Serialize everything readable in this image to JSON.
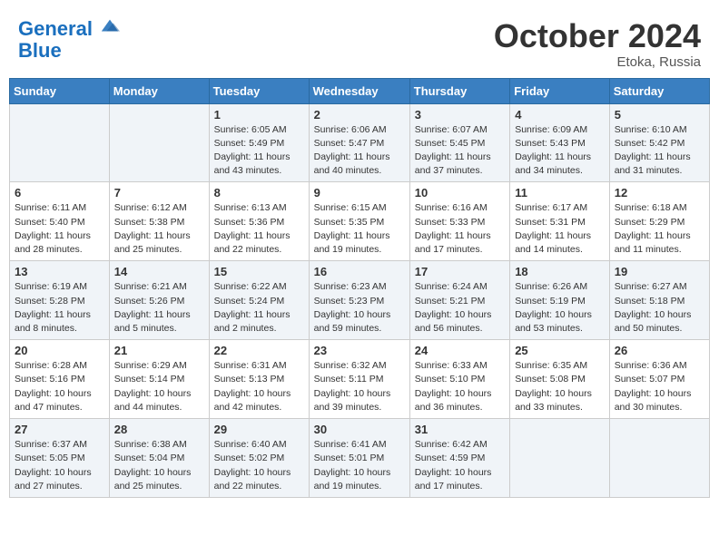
{
  "header": {
    "logo_line1": "General",
    "logo_line2": "Blue",
    "month": "October 2024",
    "location": "Etoka, Russia"
  },
  "weekdays": [
    "Sunday",
    "Monday",
    "Tuesday",
    "Wednesday",
    "Thursday",
    "Friday",
    "Saturday"
  ],
  "weeks": [
    [
      {
        "day": "",
        "info": ""
      },
      {
        "day": "",
        "info": ""
      },
      {
        "day": "1",
        "info": "Sunrise: 6:05 AM\nSunset: 5:49 PM\nDaylight: 11 hours and 43 minutes."
      },
      {
        "day": "2",
        "info": "Sunrise: 6:06 AM\nSunset: 5:47 PM\nDaylight: 11 hours and 40 minutes."
      },
      {
        "day": "3",
        "info": "Sunrise: 6:07 AM\nSunset: 5:45 PM\nDaylight: 11 hours and 37 minutes."
      },
      {
        "day": "4",
        "info": "Sunrise: 6:09 AM\nSunset: 5:43 PM\nDaylight: 11 hours and 34 minutes."
      },
      {
        "day": "5",
        "info": "Sunrise: 6:10 AM\nSunset: 5:42 PM\nDaylight: 11 hours and 31 minutes."
      }
    ],
    [
      {
        "day": "6",
        "info": "Sunrise: 6:11 AM\nSunset: 5:40 PM\nDaylight: 11 hours and 28 minutes."
      },
      {
        "day": "7",
        "info": "Sunrise: 6:12 AM\nSunset: 5:38 PM\nDaylight: 11 hours and 25 minutes."
      },
      {
        "day": "8",
        "info": "Sunrise: 6:13 AM\nSunset: 5:36 PM\nDaylight: 11 hours and 22 minutes."
      },
      {
        "day": "9",
        "info": "Sunrise: 6:15 AM\nSunset: 5:35 PM\nDaylight: 11 hours and 19 minutes."
      },
      {
        "day": "10",
        "info": "Sunrise: 6:16 AM\nSunset: 5:33 PM\nDaylight: 11 hours and 17 minutes."
      },
      {
        "day": "11",
        "info": "Sunrise: 6:17 AM\nSunset: 5:31 PM\nDaylight: 11 hours and 14 minutes."
      },
      {
        "day": "12",
        "info": "Sunrise: 6:18 AM\nSunset: 5:29 PM\nDaylight: 11 hours and 11 minutes."
      }
    ],
    [
      {
        "day": "13",
        "info": "Sunrise: 6:19 AM\nSunset: 5:28 PM\nDaylight: 11 hours and 8 minutes."
      },
      {
        "day": "14",
        "info": "Sunrise: 6:21 AM\nSunset: 5:26 PM\nDaylight: 11 hours and 5 minutes."
      },
      {
        "day": "15",
        "info": "Sunrise: 6:22 AM\nSunset: 5:24 PM\nDaylight: 11 hours and 2 minutes."
      },
      {
        "day": "16",
        "info": "Sunrise: 6:23 AM\nSunset: 5:23 PM\nDaylight: 10 hours and 59 minutes."
      },
      {
        "day": "17",
        "info": "Sunrise: 6:24 AM\nSunset: 5:21 PM\nDaylight: 10 hours and 56 minutes."
      },
      {
        "day": "18",
        "info": "Sunrise: 6:26 AM\nSunset: 5:19 PM\nDaylight: 10 hours and 53 minutes."
      },
      {
        "day": "19",
        "info": "Sunrise: 6:27 AM\nSunset: 5:18 PM\nDaylight: 10 hours and 50 minutes."
      }
    ],
    [
      {
        "day": "20",
        "info": "Sunrise: 6:28 AM\nSunset: 5:16 PM\nDaylight: 10 hours and 47 minutes."
      },
      {
        "day": "21",
        "info": "Sunrise: 6:29 AM\nSunset: 5:14 PM\nDaylight: 10 hours and 44 minutes."
      },
      {
        "day": "22",
        "info": "Sunrise: 6:31 AM\nSunset: 5:13 PM\nDaylight: 10 hours and 42 minutes."
      },
      {
        "day": "23",
        "info": "Sunrise: 6:32 AM\nSunset: 5:11 PM\nDaylight: 10 hours and 39 minutes."
      },
      {
        "day": "24",
        "info": "Sunrise: 6:33 AM\nSunset: 5:10 PM\nDaylight: 10 hours and 36 minutes."
      },
      {
        "day": "25",
        "info": "Sunrise: 6:35 AM\nSunset: 5:08 PM\nDaylight: 10 hours and 33 minutes."
      },
      {
        "day": "26",
        "info": "Sunrise: 6:36 AM\nSunset: 5:07 PM\nDaylight: 10 hours and 30 minutes."
      }
    ],
    [
      {
        "day": "27",
        "info": "Sunrise: 6:37 AM\nSunset: 5:05 PM\nDaylight: 10 hours and 27 minutes."
      },
      {
        "day": "28",
        "info": "Sunrise: 6:38 AM\nSunset: 5:04 PM\nDaylight: 10 hours and 25 minutes."
      },
      {
        "day": "29",
        "info": "Sunrise: 6:40 AM\nSunset: 5:02 PM\nDaylight: 10 hours and 22 minutes."
      },
      {
        "day": "30",
        "info": "Sunrise: 6:41 AM\nSunset: 5:01 PM\nDaylight: 10 hours and 19 minutes."
      },
      {
        "day": "31",
        "info": "Sunrise: 6:42 AM\nSunset: 4:59 PM\nDaylight: 10 hours and 17 minutes."
      },
      {
        "day": "",
        "info": ""
      },
      {
        "day": "",
        "info": ""
      }
    ]
  ]
}
